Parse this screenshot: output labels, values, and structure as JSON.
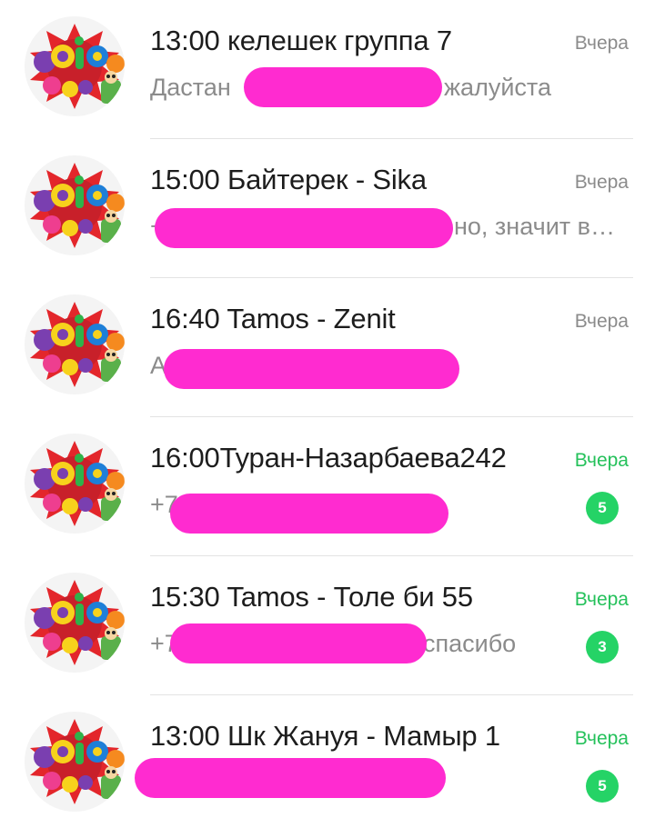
{
  "chats": [
    {
      "avatar_icon": "kids-taxi-logo-icon",
      "title": "13:00 келешек группа 7",
      "time": "Вчера",
      "unread": false,
      "preview_before": "Дастан",
      "preview_after": "жалуйста",
      "badge": null
    },
    {
      "avatar_icon": "kids-taxi-logo-icon",
      "title": "15:00 Байтерек - Sika",
      "time": "Вчера",
      "unread": false,
      "preview_before": "+",
      "preview_after": "но, значит в…",
      "badge": null
    },
    {
      "avatar_icon": "kids-taxi-logo-icon",
      "title": "16:40 Tamos - Zenit",
      "time": "Вчера",
      "unread": false,
      "preview_before": "А",
      "preview_after": "",
      "badge": null
    },
    {
      "avatar_icon": "kids-taxi-logo-icon",
      "title": "16:00Туран-Назарбаева242",
      "time": "Вчера",
      "unread": true,
      "preview_before": "+7",
      "preview_after": "",
      "badge": "5"
    },
    {
      "avatar_icon": "kids-taxi-logo-icon",
      "title": "15:30 Tamos - Толе би 55",
      "time": "Вчера",
      "unread": true,
      "preview_before": "+7",
      "preview_after": "спасибо",
      "badge": "3"
    },
    {
      "avatar_icon": "kids-taxi-logo-icon",
      "title": "13:00 Шк Жануя - Мамыр 1",
      "time": "Вчера",
      "unread": true,
      "preview_before": "",
      "preview_after": "",
      "badge": "5"
    }
  ],
  "colors": {
    "unread_accent": "#25d366",
    "redaction": "#ff2bd0"
  }
}
